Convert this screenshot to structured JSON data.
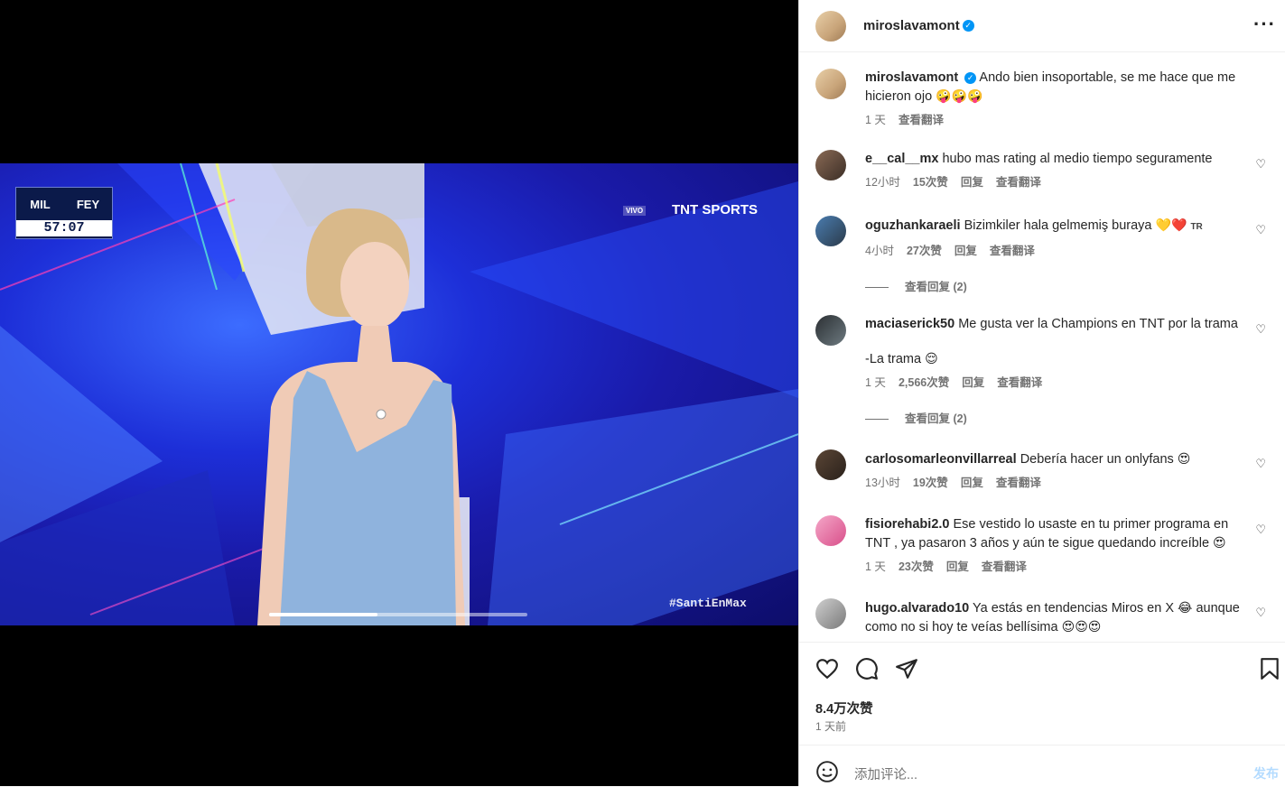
{
  "post": {
    "author": "miroslavamont",
    "verified_mark": "✓",
    "more_label": "···"
  },
  "video": {
    "score_clock": "57:07",
    "team_home": "MIL",
    "team_away": "FEY",
    "live_tag": "VIVO",
    "channel": "TNT SPORTS",
    "hashtag": "#SantiEnMax",
    "progress": 0.42,
    "accent_bg": "#1d2fd8"
  },
  "caption": {
    "username": "miroslavamont",
    "text": "Ando bien insoportable, se me hace que me hicieron ojo",
    "emojis": "🤪🤪🤪",
    "time": "1 天",
    "translate": "查看翻译"
  },
  "comments": [
    {
      "username": "e__cal__mx",
      "text": "hubo mas rating al medio tiempo seguramente",
      "time": "12小时",
      "likes": "15次赞",
      "reply": "回复",
      "translate": "查看翻译"
    },
    {
      "username": "oguzhankaraeli",
      "text": "Bizimkiler hala gelmemiş buraya",
      "emojis": "💛❤️",
      "suffix": "TR",
      "time": "4小时",
      "likes": "27次赞",
      "reply": "回复",
      "translate": "查看翻译",
      "view_replies": "查看回复 (2)"
    },
    {
      "username": "maciaserick50",
      "text": "Me gusta ver la Champions en TNT por la trama",
      "line2": "-La trama",
      "emojis": "😌",
      "time": "1 天",
      "likes": "2,566次赞",
      "reply": "回复",
      "translate": "查看翻译",
      "view_replies": "查看回复 (2)"
    },
    {
      "username": "carlosomarleonvillarreal",
      "text": "Debería hacer un onlyfans",
      "emojis": "😍",
      "time": "13小时",
      "likes": "19次赞",
      "reply": "回复",
      "translate": "查看翻译"
    },
    {
      "username": "fisiorehabi2.0",
      "text": "Ese vestido lo usaste en tu primer programa en TNT , ya pasaron 3 años y aún te sigue quedando increíble",
      "emojis": "😍",
      "time": "1 天",
      "likes": "23次赞",
      "reply": "回复",
      "translate": "查看翻译"
    },
    {
      "username": "hugo.alvarado10",
      "text": "Ya estás en tendencias Miros en X",
      "emojis_mid": "😂",
      "text2": "aunque como no si hoy te veías bellísima",
      "emojis": "😍😍😍"
    }
  ],
  "footer": {
    "likes": "8.4万次赞",
    "ago": "1 天前",
    "add_comment_placeholder": "添加评论...",
    "post_label": "发布"
  }
}
